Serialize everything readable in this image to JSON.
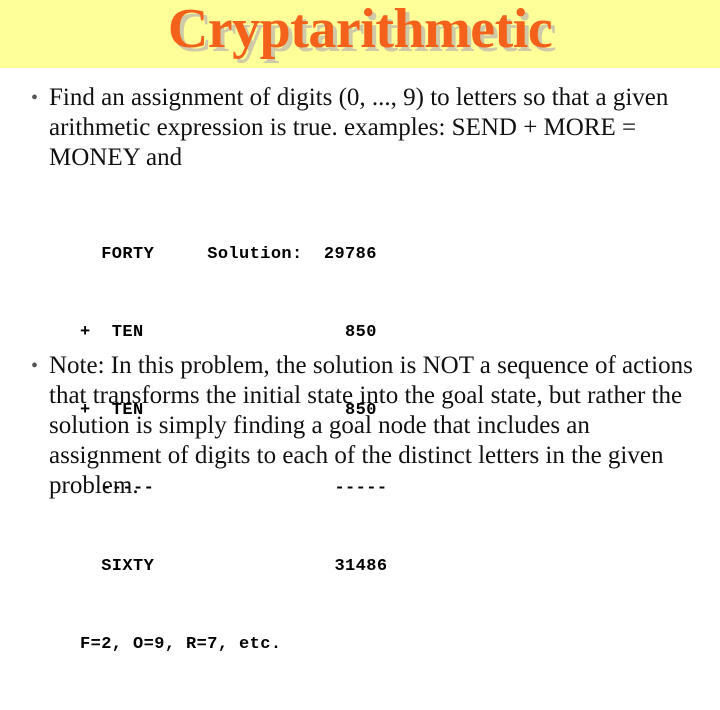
{
  "slide": {
    "title": "Cryptarithmetic",
    "background_color": "#ffffff",
    "title_band_color": "#ffff99",
    "title_color": "#f4611a",
    "title_shadow_color": "#cfc9a8",
    "body_text_color": "#111111"
  },
  "bullets": [
    {
      "marker": "•",
      "text": "Find an assignment of digits (0, ..., 9) to letters so that a given arithmetic expression is true.  examples: SEND + MORE = MONEY and"
    },
    {
      "marker": "•",
      "text": "Note: In this problem, the solution is NOT a sequence of actions that transforms the initial state into the goal state, but rather the solution is simply finding a goal node that includes an assignment of digits to each of the distinct letters in the given problem."
    }
  ],
  "puzzle": {
    "lines": [
      "  FORTY     Solution:  29786",
      "+  TEN                   850",
      "+  TEN                   850",
      "  -----                 -----",
      "  SIXTY                 31486",
      "F=2, O=9, R=7, etc."
    ],
    "addend_1": "FORTY",
    "addend_2": "TEN",
    "addend_3": "TEN",
    "sum_word": "SIXTY",
    "solution_label": "Solution:",
    "solution_1": "29786",
    "solution_2": "850",
    "solution_3": "850",
    "solution_sum": "31486",
    "rule_left": "-----",
    "rule_right": "-----",
    "assignments": "F=2, O=9, R=7, etc."
  }
}
